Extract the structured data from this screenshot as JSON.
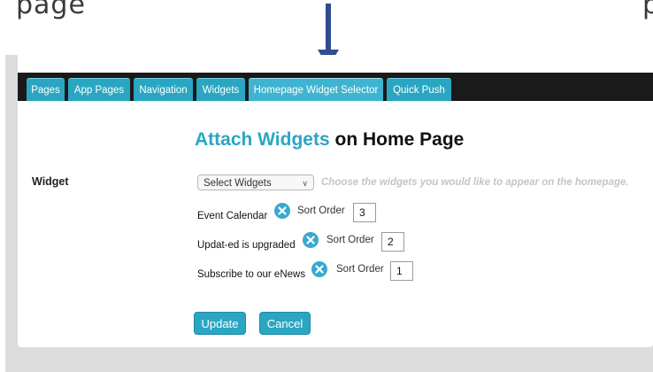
{
  "caption": {
    "left_text": "page",
    "right_text": "p"
  },
  "tabs": [
    {
      "label": "Pages"
    },
    {
      "label": "App Pages"
    },
    {
      "label": "Navigation"
    },
    {
      "label": "Widgets"
    },
    {
      "label": "Homepage Widget Selector",
      "active": true
    },
    {
      "label": "Quick Push"
    }
  ],
  "page": {
    "title_accent": "Attach Widgets",
    "title_rest": " on Home Page",
    "widget_label": "Widget"
  },
  "select": {
    "value": "Select Widgets",
    "hint": "Choose the widgets you would like to appear on the homepage."
  },
  "widgets": [
    {
      "name": "Event Calendar",
      "sort_label": "Sort Order",
      "sort_value": "3"
    },
    {
      "name": "Updat-ed is upgraded",
      "sort_label": "Sort Order",
      "sort_value": "2"
    },
    {
      "name": "Subscribe to our eNews",
      "sort_label": "Sort Order",
      "sort_value": "1"
    }
  ],
  "buttons": {
    "update": "Update",
    "cancel": "Cancel"
  },
  "colors": {
    "accent": "#2aa6c2",
    "tabbar": "#1a1a1a",
    "arrow": "#2f4d8f"
  }
}
